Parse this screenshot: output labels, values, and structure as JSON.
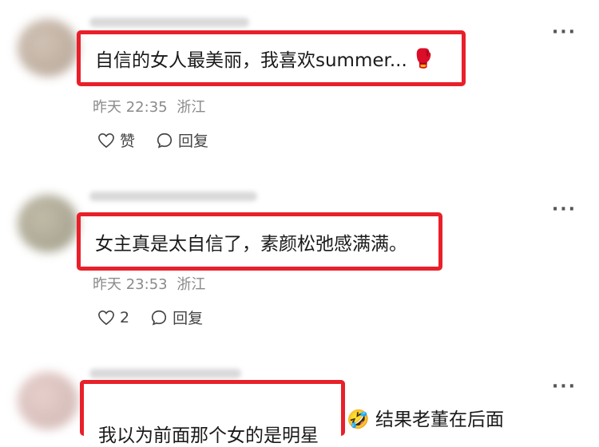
{
  "comments": [
    {
      "text": "自信的女人最美丽，我喜欢summer...",
      "emoji": "🥊",
      "time": "昨天 22:35",
      "location": "浙江",
      "like_count": "",
      "like_label": "赞",
      "reply_label": "回复",
      "more_label": "···"
    },
    {
      "text": "女主真是太自信了，素颜松弛感满满。",
      "time": "昨天 23:53",
      "location": "浙江",
      "like_count": "2",
      "reply_label": "回复",
      "more_label": "···"
    },
    {
      "text": "我以为前面那个女的是明星",
      "emoji": "🤣",
      "text_tail": "结果老董在后面",
      "more_label": "···"
    }
  ],
  "colors": {
    "highlight_border": "#e8202a",
    "meta_text": "#8a8a8a"
  }
}
